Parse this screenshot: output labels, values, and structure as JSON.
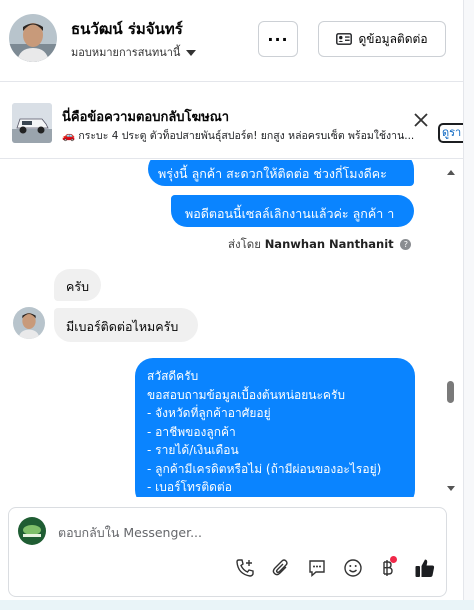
{
  "header": {
    "name": "ธนวัฒน์ ร่มจันทร์",
    "assign_label": "มอบหมายการสนทนานี้",
    "more_label": "···",
    "contact_button": "ดูข้อมูลติดต่อ"
  },
  "ad": {
    "title": "นี่คือข้อความตอบกลับโฆษณา",
    "text": "🚗 กระบะ 4 ประตู ตัวท็อปสายพันธุ์สปอร์ต! ยกสูง หล่อครบเซ็ต พร้อมใช้งาน...",
    "chip": "ดูรา"
  },
  "messages": {
    "out1": "พรุ่งนี้ ลูกค้า  สะดวกให้ติดต่อ ช่วงกี่โมงดีคะ",
    "out2": "พอดีตอนนี้เซลล์เลิกงานแล้วค่ะ  ลูกค้า า",
    "sent_by_prefix": "ส่งโดย",
    "sent_by_name": "Nanwhan Nanthanit",
    "info_icon_text": "?",
    "in1": "ครับ",
    "in2": "มีเบอร์ติดต่อไหมครับ",
    "out3_lines": [
      "สวัสดีครับ",
      "ขอสอบถามข้อมูลเบื้องต้นหน่อยนะครับ",
      "- จังหวัดที่ลูกค้าอาศัยอยู่",
      "- อาชีพของลูกค้า",
      "- รายได้/เงินเดือน",
      "- ลูกค้ามีเครดิตหรือไม่ (ถ้ามีผ่อนของอะไรอยู่)",
      "- เบอร์โทรติดต่อ"
    ]
  },
  "composer": {
    "placeholder": "ตอบกลับใน Messenger...",
    "tools": [
      "phone-plus-icon",
      "paperclip-icon",
      "chat-bubble-icon",
      "emoji-icon",
      "baht-icon",
      "thumbs-up-icon"
    ]
  },
  "colors": {
    "outgoing_bubble": "#0a84ff",
    "incoming_bubble": "#f0f0f0",
    "notification_dot": "#f02849",
    "chip_text": "#0a66c2"
  }
}
